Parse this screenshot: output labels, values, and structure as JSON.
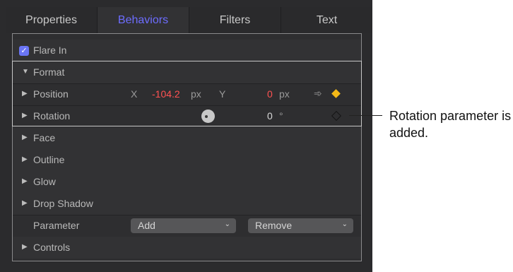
{
  "tabs": [
    {
      "label": "Properties",
      "active": false
    },
    {
      "label": "Behaviors",
      "active": true
    },
    {
      "label": "Filters",
      "active": false
    },
    {
      "label": "Text",
      "active": false
    }
  ],
  "behavior": {
    "label": "Flare In",
    "checked": true
  },
  "format": {
    "label": "Format"
  },
  "position": {
    "label": "Position",
    "x_label": "X",
    "x_value": "-104.2",
    "x_unit": "px",
    "y_label": "Y",
    "y_value": "0",
    "y_unit": "px"
  },
  "rotation": {
    "label": "Rotation",
    "value": "0",
    "unit": "°"
  },
  "sections": [
    "Face",
    "Outline",
    "Glow",
    "Drop Shadow"
  ],
  "parameter": {
    "label": "Parameter",
    "add_label": "Add",
    "remove_label": "Remove"
  },
  "controls": {
    "label": "Controls"
  },
  "callout": {
    "text": "Rotation parameter is added."
  },
  "colors": {
    "accent": "#6d6dff",
    "keyframe": "#f4b917",
    "red_value": "#ff5252"
  }
}
